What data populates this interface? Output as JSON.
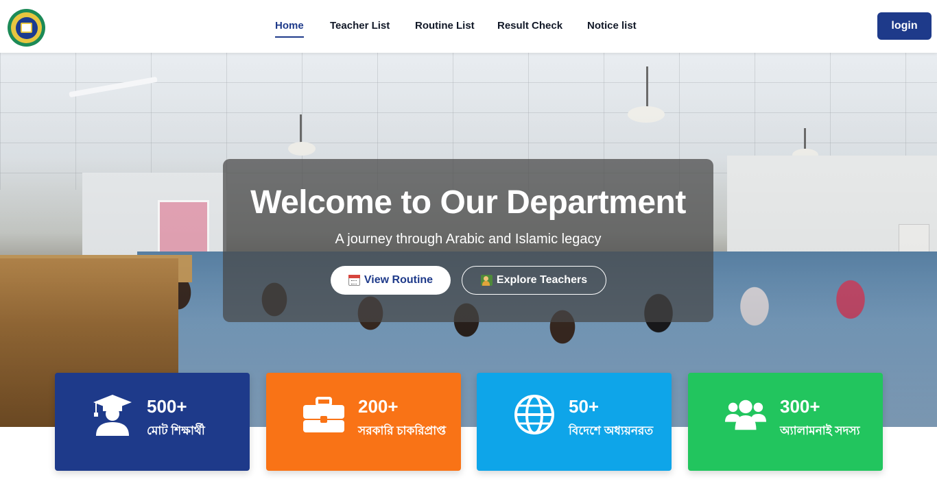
{
  "nav": {
    "logo_icon": "institution-seal-icon",
    "links": [
      {
        "label": "Home",
        "active": true
      },
      {
        "label": "Teacher List",
        "active": false
      },
      {
        "label": "Routine List",
        "active": false
      },
      {
        "label": "Result Check",
        "active": false
      },
      {
        "label": "Notice list",
        "active": false
      }
    ],
    "login_label": "login"
  },
  "hero": {
    "title": "Welcome to Our Department",
    "subtitle": "A journey through Arabic and Islamic legacy",
    "routine_button": {
      "label": "View Routine",
      "icon": "calendar-icon"
    },
    "teachers_button": {
      "label": "Explore Teachers",
      "icon": "teacher-icon"
    }
  },
  "stats": [
    {
      "value": "500+",
      "label": "মোট শিক্ষার্থী",
      "icon": "graduate-icon",
      "color": "#1e3a8a"
    },
    {
      "value": "200+",
      "label": "সরকারি চাকরিপ্রাপ্ত",
      "icon": "briefcase-icon",
      "color": "#f97316"
    },
    {
      "value": "50+",
      "label": "বিদেশে অধ্যয়নরত",
      "icon": "globe-icon",
      "color": "#0ea5e9"
    },
    {
      "value": "300+",
      "label": "অ্যালামনাই সদস্য",
      "icon": "users-icon",
      "color": "#22c55e"
    }
  ],
  "colors": {
    "primary": "#1e3a8a",
    "nav_text": "#111827"
  }
}
